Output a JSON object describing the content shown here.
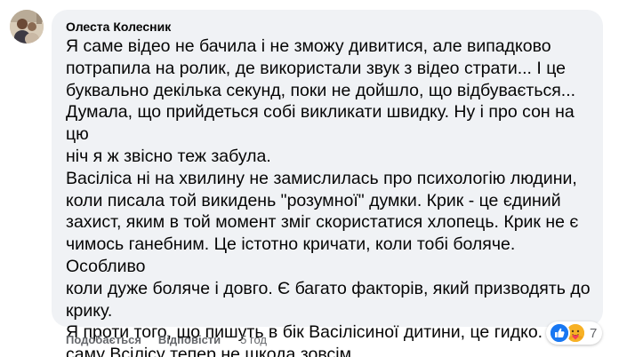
{
  "faded_top_text": "· · · · · ·  · ·  ·  ·  ·  ·    ·   · ·  ·   ·  ·  ·  ·  ·   ·  ·  ·  ·   ·",
  "comment": {
    "author": "Олеста Колесник",
    "text": "Я саме відео не бачила і не зможу дивитися, але випадково\nпотрапила на ролик, де використали звук з відео страти... І це\nбуквально декілька секунд, поки не дойшло, що відбувається...\nДумала, що прийдеться собі викликати швидку. Ну і про сон на цю\nніч я ж звісно теж забула.\nВасіліса ні на хвилину не замислилась про психологію людини,\nколи писала той викидень \"розумної\" думки. Крик - це єдиний\nзахист, яким в той момент зміг скористатися хлопець. Крик не є\nчимось ганебним. Це істотно кричати, коли тобі боляче. Особливо\nколи дуже боляче і довго. Є багато факторів, який призводять до\nкрику.\nЯ проти того, що пишуть в бік Васілісиної дитини, це гидко. А от\nсаму Всілісу тепер не шкода зовсім."
  },
  "actions": {
    "like": "Подобається",
    "reply": "Відповісти",
    "time": "5 год"
  },
  "reactions": {
    "icons": [
      "like-reaction",
      "care-reaction"
    ],
    "count": "7",
    "colors": {
      "like": "#1877f2",
      "care": "#f7b125",
      "heart": "#f33e58"
    }
  },
  "colors": {
    "bubble": "#f0f2f5",
    "text": "#050505",
    "secondary": "#65676b"
  }
}
